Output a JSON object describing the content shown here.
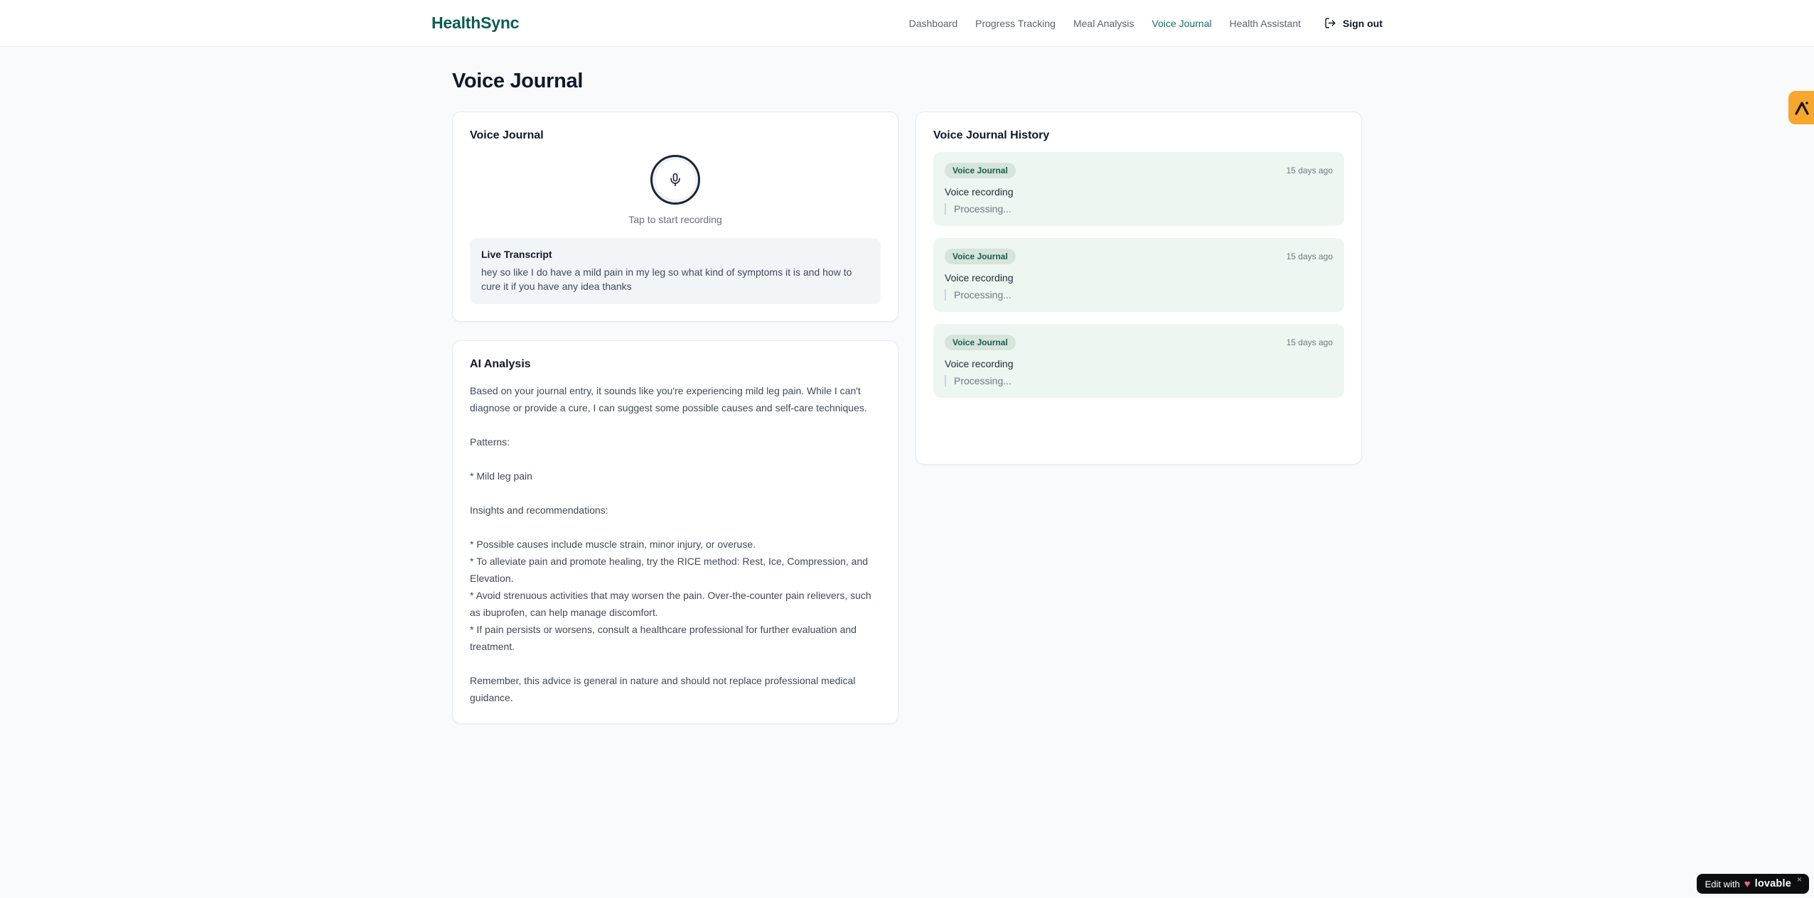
{
  "brand": "HealthSync",
  "nav": {
    "items": [
      {
        "label": "Dashboard"
      },
      {
        "label": "Progress Tracking"
      },
      {
        "label": "Meal Analysis"
      },
      {
        "label": "Voice Journal"
      },
      {
        "label": "Health Assistant"
      }
    ],
    "signout_label": "Sign out"
  },
  "page": {
    "title": "Voice Journal"
  },
  "recorder": {
    "title": "Voice Journal",
    "tap_hint": "Tap to start recording",
    "live_transcript_label": "Live Transcript",
    "transcript": "hey so like I do have a mild pain in my leg so what kind of symptoms it is and how to cure it if you have any idea thanks"
  },
  "analysis": {
    "title": "AI Analysis",
    "body": "Based on your journal entry, it sounds like you're experiencing mild leg pain. While I can't diagnose or provide a cure, I can suggest some possible causes and self-care techniques.\n\nPatterns:\n\n* Mild leg pain\n\nInsights and recommendations:\n\n* Possible causes include muscle strain, minor injury, or overuse.\n* To alleviate pain and promote healing, try the RICE method: Rest, Ice, Compression, and Elevation.\n* Avoid strenuous activities that may worsen the pain. Over-the-counter pain relievers, such as ibuprofen, can help manage discomfort.\n* If pain persists or worsens, consult a healthcare professional for further evaluation and treatment.\n\nRemember, this advice is general in nature and should not replace professional medical guidance."
  },
  "history": {
    "title": "Voice Journal History",
    "entries": [
      {
        "badge": "Voice Journal",
        "time": "15 days ago",
        "title": "Voice recording",
        "status": "Processing..."
      },
      {
        "badge": "Voice Journal",
        "time": "15 days ago",
        "title": "Voice recording",
        "status": "Processing..."
      },
      {
        "badge": "Voice Journal",
        "time": "15 days ago",
        "title": "Voice recording",
        "status": "Processing..."
      }
    ]
  },
  "lovable": {
    "prefix": "Edit with",
    "brand": "lovable",
    "heart": "♥",
    "close": "×"
  },
  "colors": {
    "brand_green": "#0b5d50",
    "nav_active": "#0e7569",
    "entry_bg": "#edf6f0",
    "badge_bg": "#d6e4db",
    "badge_text": "#175c4c",
    "side_tag_orange": "#f6a72c",
    "page_bg": "#f8fafc"
  }
}
